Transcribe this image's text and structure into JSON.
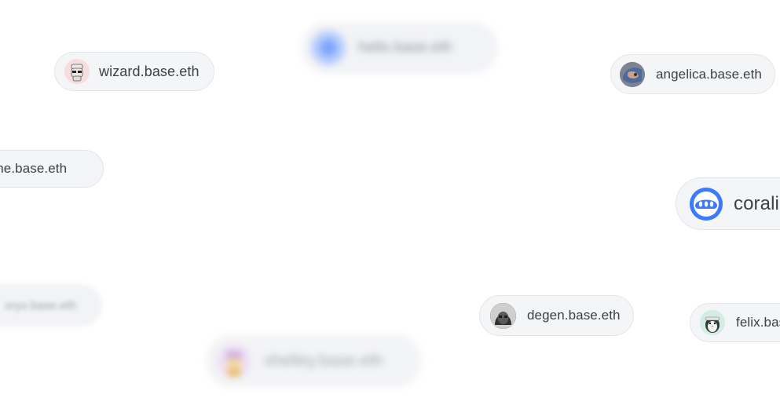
{
  "pills": {
    "hello": {
      "label": "hello.base.eth",
      "avatar_icon": "globe-avatar-icon"
    },
    "wizard": {
      "label": "wizard.base.eth",
      "avatar_icon": "wizard-avatar-icon"
    },
    "angelica": {
      "label": "angelica.base.eth",
      "avatar_icon": "photo-avatar-icon"
    },
    "coraline_left": {
      "label": "coraline.base.eth"
    },
    "coraline_right": {
      "label": "coraline.base.eth",
      "avatar_icon": "base-ghost-avatar-icon"
    },
    "oryx": {
      "label": "oryx.base.eth"
    },
    "degen": {
      "label": "degen.base.eth",
      "avatar_icon": "hooded-avatar-icon"
    },
    "felix": {
      "label": "felix.base.eth",
      "avatar_icon": "penguin-avatar-icon"
    },
    "shelley": {
      "label": "shelley.base.eth",
      "avatar_icon": "character-avatar-icon"
    }
  },
  "colors": {
    "pill_background": "#f4f5f7",
    "pill_border": "#e3e5e9",
    "text": "#3c3f47",
    "accent_blue": "#3c7bff"
  }
}
